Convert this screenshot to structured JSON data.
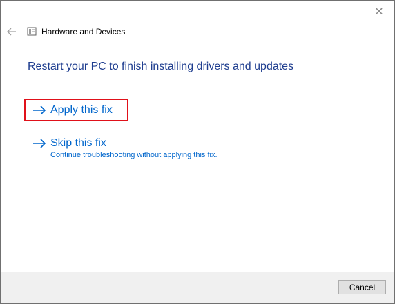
{
  "window": {
    "title": "Hardware and Devices",
    "close_glyph": "✕"
  },
  "heading": "Restart your PC to finish installing drivers and updates",
  "options": [
    {
      "label": "Apply this fix",
      "description": ""
    },
    {
      "label": "Skip this fix",
      "description": "Continue troubleshooting without applying this fix."
    }
  ],
  "footer": {
    "cancel_label": "Cancel"
  },
  "colors": {
    "heading": "#1e3d8f",
    "link": "#0066cc",
    "highlight": "#e0111a"
  },
  "icons": {
    "back": "back-arrow-icon",
    "app": "troubleshooter-icon",
    "option": "right-arrow-icon",
    "close": "close-icon"
  }
}
